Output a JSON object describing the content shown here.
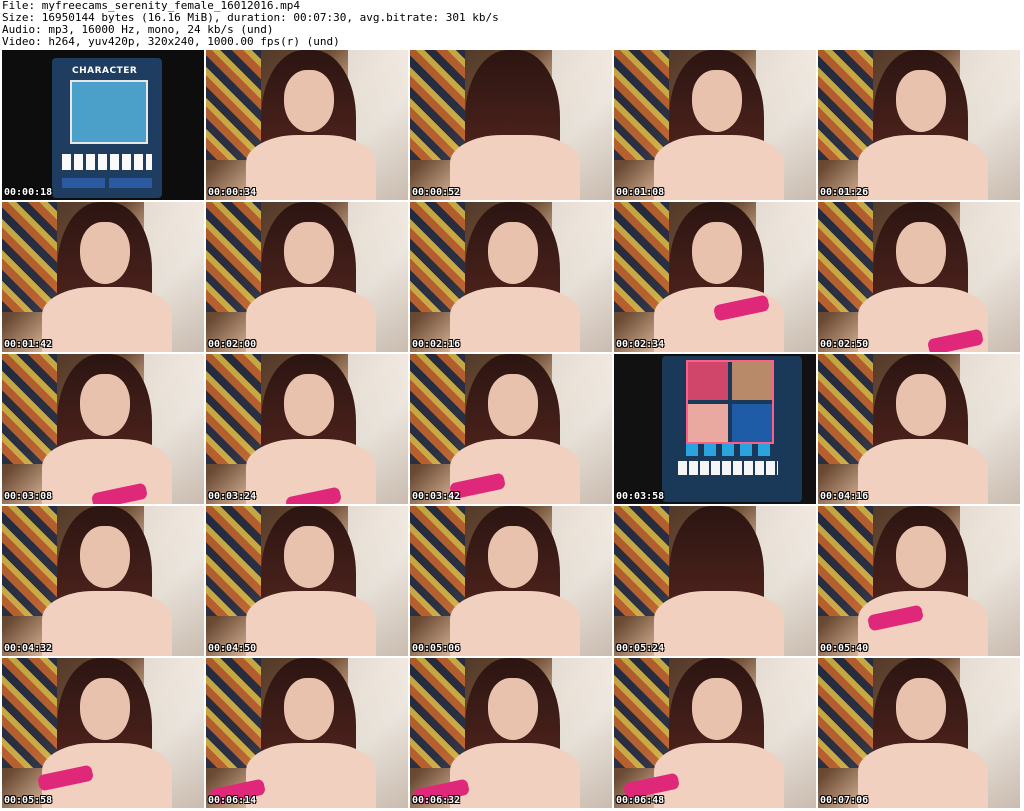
{
  "header": {
    "line1": "File: myfreecams_serenity_female_16012016.mp4",
    "line2": "Size: 16950144 bytes (16.16 MiB), duration: 00:07:30, avg.bitrate: 301 kb/s",
    "line3": "Audio: mp3, 16000 Hz, mono, 24 kb/s (und)",
    "line4": "Video: h264, yuv420p, 320x240, 1000.00 fps(r) (und)"
  },
  "screen_text": {
    "character_label": "CHARACTER"
  },
  "thumbnails": [
    {
      "timestamp": "00:00:18"
    },
    {
      "timestamp": "00:00:34"
    },
    {
      "timestamp": "00:00:52"
    },
    {
      "timestamp": "00:01:08"
    },
    {
      "timestamp": "00:01:26"
    },
    {
      "timestamp": "00:01:42"
    },
    {
      "timestamp": "00:02:00"
    },
    {
      "timestamp": "00:02:16"
    },
    {
      "timestamp": "00:02:34"
    },
    {
      "timestamp": "00:02:50"
    },
    {
      "timestamp": "00:03:08"
    },
    {
      "timestamp": "00:03:24"
    },
    {
      "timestamp": "00:03:42"
    },
    {
      "timestamp": "00:03:58"
    },
    {
      "timestamp": "00:04:16"
    },
    {
      "timestamp": "00:04:32"
    },
    {
      "timestamp": "00:04:50"
    },
    {
      "timestamp": "00:05:06"
    },
    {
      "timestamp": "00:05:24"
    },
    {
      "timestamp": "00:05:40"
    },
    {
      "timestamp": "00:05:58"
    },
    {
      "timestamp": "00:06:14"
    },
    {
      "timestamp": "00:06:32"
    },
    {
      "timestamp": "00:06:48"
    },
    {
      "timestamp": "00:07:06"
    }
  ]
}
